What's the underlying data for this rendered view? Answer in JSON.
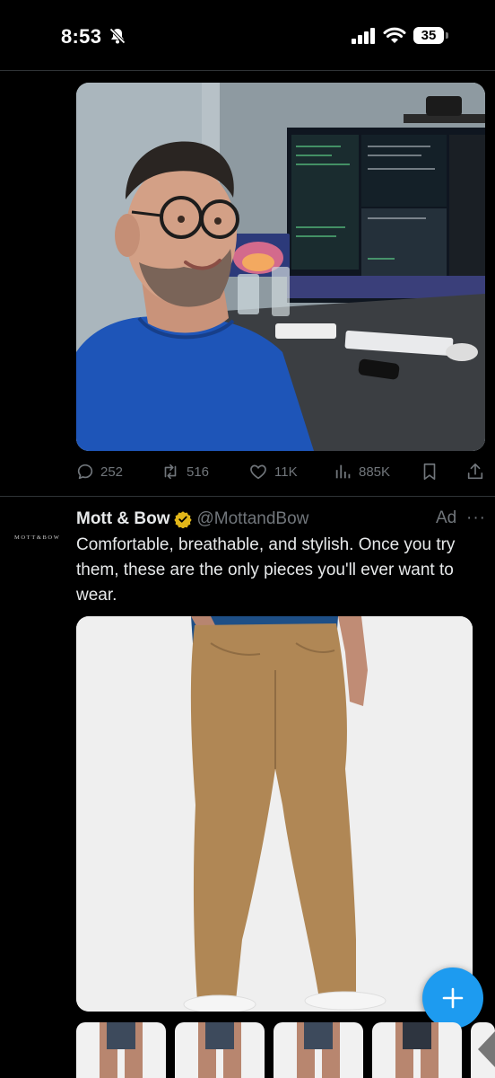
{
  "status_bar": {
    "time": "8:53",
    "battery": "35",
    "icons": [
      "bell-slash-icon",
      "signal-icon",
      "wifi-icon",
      "battery-icon"
    ]
  },
  "tweet": {
    "stats": {
      "replies": "252",
      "reposts": "516",
      "likes": "11K",
      "views": "885K"
    },
    "icons": [
      "reply-icon",
      "repost-icon",
      "like-icon",
      "views-icon",
      "bookmark-icon",
      "share-icon"
    ]
  },
  "ad": {
    "logo_text": "MOTT&BOW",
    "name": "Mott & Bow",
    "handle": "@MottandBow",
    "tag": "Ad",
    "more": "···",
    "text": "Comfortable, breathable, and stylish. Once you try them, these are the only pieces you'll ever want to wear.",
    "thumbnail_count": 5
  },
  "colors": {
    "background": "#000000",
    "accent": "#1d9bf0",
    "muted": "#71767b",
    "text": "#e7e9ea",
    "divider": "#2f3336",
    "verified": "#e2b719"
  }
}
